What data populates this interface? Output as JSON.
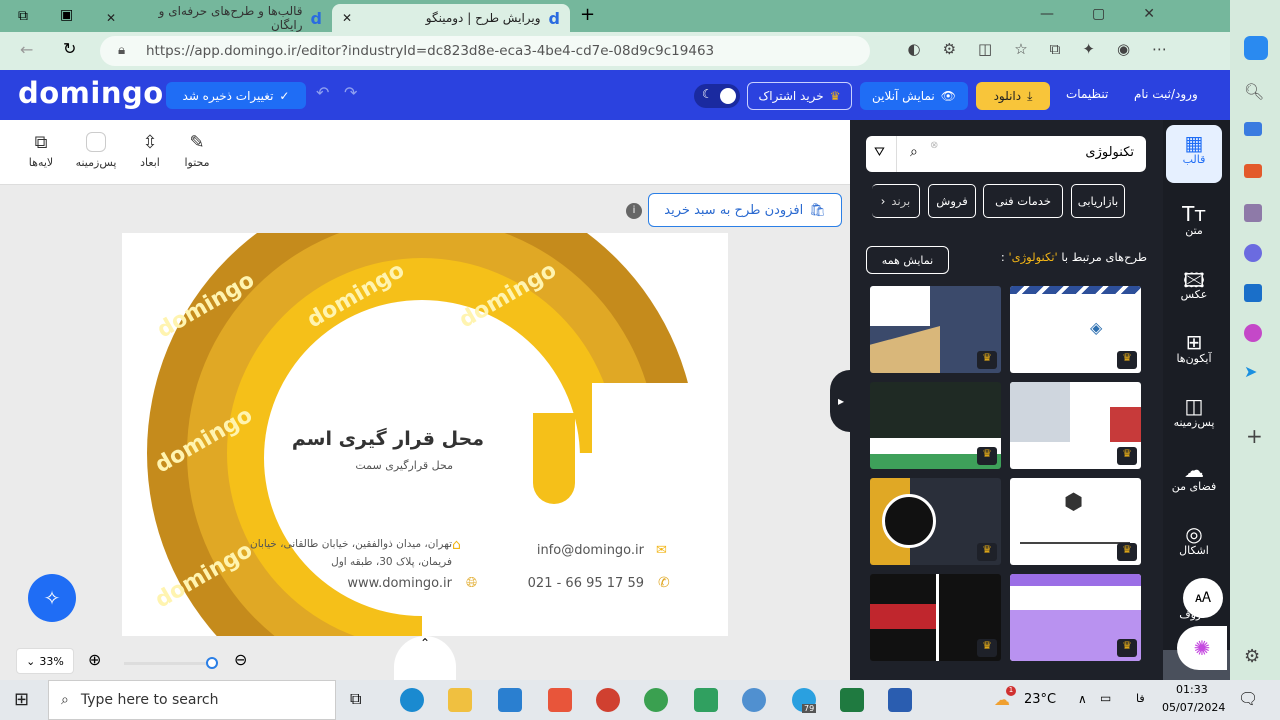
{
  "browser": {
    "tabs": [
      {
        "title": "قالب‌ها و طرح‌های حرفه‌ای و رایگان"
      },
      {
        "title": "ویرایش طرح | دومینگو",
        "active": true
      }
    ],
    "url": "https://app.domingo.ir/editor?industryId=dc823d8e-eca3-4be4-cd7e-08d9c9c19463"
  },
  "header": {
    "logo": "domingo",
    "saved_label": "تغییرات ذخیره شد",
    "subscribe_label": "خرید اشتراک",
    "preview_label": "نمایش آنلاین",
    "download_label": "دانلود",
    "settings_label": "تنظیمات",
    "login_label": "ورود/ثبت نام",
    "accent": "#2b42df"
  },
  "toolbar": {
    "content": "محتوا",
    "dimensions": "ابعاد",
    "background": "پس‌زمینه",
    "layers": "لایه‌ها"
  },
  "canvas": {
    "add_to_cart": "افزودن طرح به سبد خرید",
    "zoom": "33%",
    "card": {
      "watermark": "domingo",
      "name": "محل قرار گیری اسم",
      "role": "محل قرارگیری سمت",
      "email": "info@domingo.ir",
      "phone": "021 - 66 95 17 59",
      "address_line1": "تهران، میدان ذوالفقین، خیابان طالقانی، خیابان",
      "address_line2": "فریمان، پلاک 30، طبقه اول",
      "website": "www.domingo.ir"
    }
  },
  "panel": {
    "search_value": "تکنولوژی",
    "chips": [
      "بازاریابی",
      "خدمات فنی",
      "فروش",
      "برند"
    ],
    "related_prefix": "طرح‌های مرتبط با",
    "related_term": "'تکنولوژی'",
    "related_suffix": ":",
    "show_all": "نمایش همه",
    "highlight": "#f2b516"
  },
  "rail": {
    "items": [
      "قالب",
      "متن",
      "عکس",
      "آیکون‌ها",
      "پس‌زمینه",
      "فضای من",
      "اشکال",
      "حروف"
    ]
  },
  "taskbar": {
    "search_placeholder": "Type here to search",
    "temp": "23°C",
    "lang": "فا",
    "time": "01:33",
    "date": "05/07/2024",
    "badge": "79",
    "weather_badge": "1"
  }
}
